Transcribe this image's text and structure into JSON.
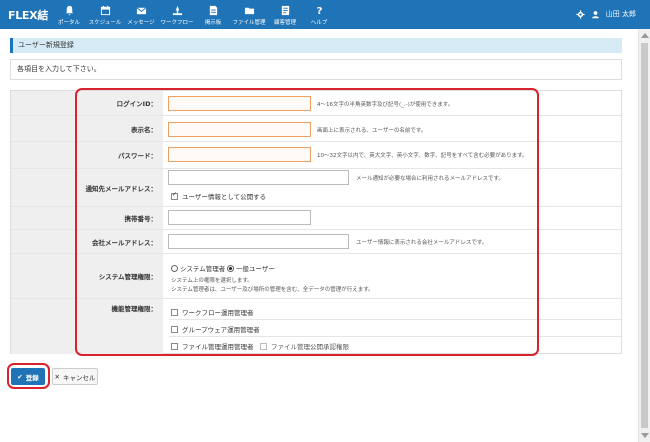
{
  "app": {
    "logo": "FLEX結",
    "user_name": "山田 太郎"
  },
  "nav": [
    {
      "label": "ポータル",
      "icon": "bell-icon"
    },
    {
      "label": "スケジュール",
      "icon": "calendar-icon"
    },
    {
      "label": "メッセージ",
      "icon": "mail-icon"
    },
    {
      "label": "ワークフロー",
      "icon": "workflow-icon"
    },
    {
      "label": "掲示板",
      "icon": "board-icon"
    },
    {
      "label": "ファイル管理",
      "icon": "folder-icon"
    },
    {
      "label": "顧客管理",
      "icon": "customer-icon"
    },
    {
      "label": "ヘルプ",
      "icon": "help-icon"
    }
  ],
  "page": {
    "title": "ユーザー新規登録",
    "notice": "各項目を入力して下さい。"
  },
  "form": {
    "login_id": {
      "label": "ログインID：",
      "value": "",
      "help": "4～16文字の半角英数字及び記号(_.-)が使用できます。"
    },
    "display_name": {
      "label": "表示名：",
      "value": "",
      "help": "画面上に表示される、ユーザーの名前です。"
    },
    "password": {
      "label": "パスワード：",
      "value": "",
      "help": "10～32文字以内で、英大文字、英小文字、数字、記号をすべて含む必要があります。"
    },
    "notify_email": {
      "label": "通知先メールアドレス：",
      "value": "",
      "help": "メール通知が必要な場合に利用されるメールアドレスです。",
      "publish_label": "ユーザー情報として公開する",
      "publish_checked": true
    },
    "mobile": {
      "label": "携帯番号：",
      "value": ""
    },
    "company_email": {
      "label": "会社メールアドレス：",
      "value": "",
      "help": "ユーザー情報に表示される会社メールアドレスです。"
    },
    "system_role": {
      "label": "システム管理権限：",
      "options": [
        "システム管理者",
        "一般ユーザー"
      ],
      "selected": "一般ユーザー",
      "help_line1": "システム上の権限を選択します。",
      "help_line2": "システム管理者は、ユーザー及び場所の管理を含む、全データの管理が行えます。"
    },
    "function_role": {
      "label": "機能管理権限：",
      "options": [
        "ワークフロー運用管理者",
        "グループウェア運用管理者",
        "ファイル管理運用管理者",
        "ファイル管理公開承認権限"
      ]
    }
  },
  "buttons": {
    "save": "登録",
    "cancel": "キャンセル"
  },
  "colors": {
    "header": "#1f73b7",
    "highlight": "#d9232e",
    "required_border": "#f0a060"
  }
}
